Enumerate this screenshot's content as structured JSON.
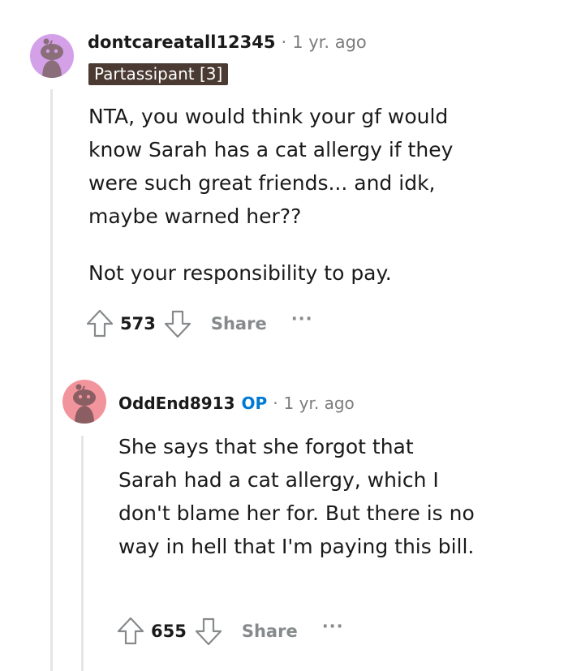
{
  "comment1": {
    "username": "dontcareatall12345",
    "separator": "·",
    "time": "1 yr. ago",
    "flair": "Partassipant [3]",
    "body": [
      "NTA, you would think your gf would know Sarah has a cat allergy if they were such great friends... and idk, maybe warned her??",
      "Not your responsibility to pay."
    ],
    "score": "573",
    "share_label": "Share",
    "more_label": "···",
    "avatar_color": "#d4a0e8"
  },
  "comment2": {
    "username": "OddEnd8913",
    "op_badge": "OP",
    "separator": "·",
    "time": "1 yr. ago",
    "body": [
      "She says that she forgot that Sarah had a cat allergy, which I don't blame her for. But there is no way in hell that I'm paying this bill."
    ],
    "score": "655",
    "share_label": "Share",
    "more_label": "···",
    "avatar_color": "#f2949c"
  },
  "icons": {
    "upvote": "upvote-arrow-icon",
    "downvote": "downvote-arrow-icon",
    "avatar": "reddit-snoo-icon"
  }
}
